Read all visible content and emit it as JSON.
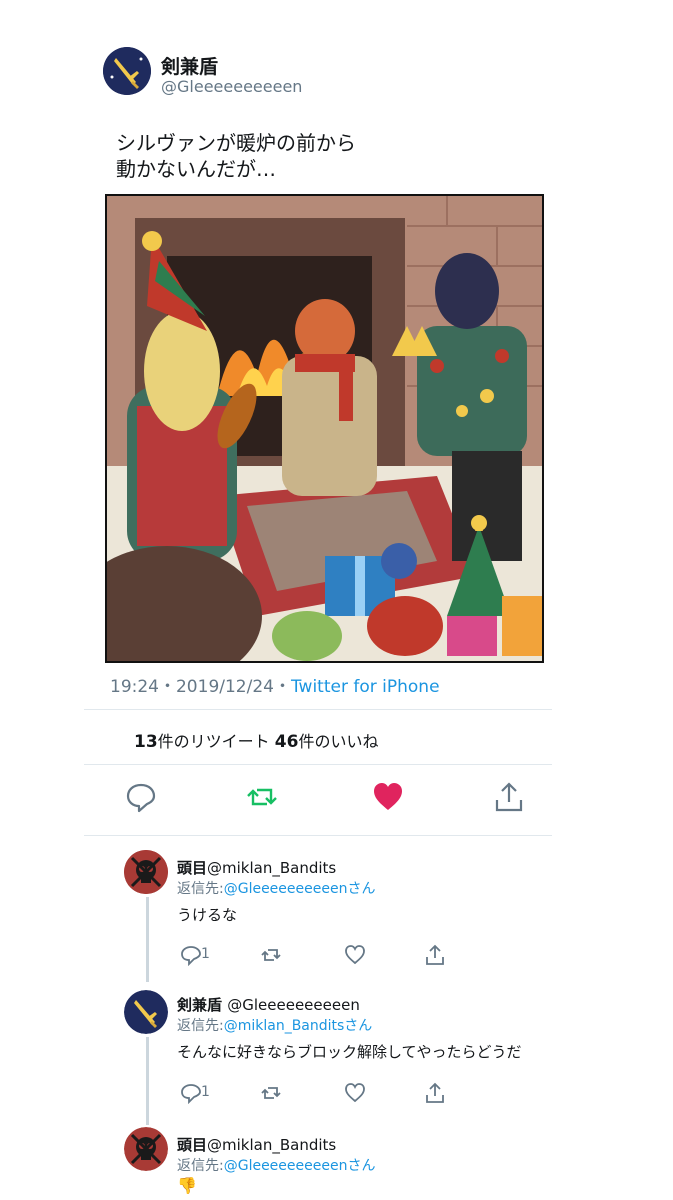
{
  "tweet": {
    "display_name": "剣兼盾",
    "handle": "@Gleeeeeeeeeen",
    "text": "シルヴァンが暖炉の前から\n動かないんだが…",
    "timestamp": "19:24・2019/12/24・",
    "source": "Twitter for iPhone",
    "retweets_count": "13",
    "retweets_label": "件のリツイート",
    "likes_count": "46",
    "likes_label": "件のいいね",
    "colors": {
      "accent": "#1b95e0",
      "retweet": "#17bf63",
      "like": "#e0245e",
      "muted": "#657786"
    }
  },
  "replies": [
    {
      "name": "頭目",
      "handle": "@miklan_Bandits",
      "reply_prefix": "返信先:",
      "reply_target": "@Gleeeeeeeeeenさん",
      "text": "うけるな",
      "reply_count": "1"
    },
    {
      "name": "剣兼盾",
      "handle": "@Gleeeeeeeeeen",
      "reply_prefix": "返信先:",
      "reply_target": "@miklan_Banditsさん",
      "text": "そんなに好きならブロック解除してやったらどうだ",
      "reply_count": "1"
    },
    {
      "name": "頭目",
      "handle": "@miklan_Bandits",
      "reply_prefix": "返信先:",
      "reply_target": "@Gleeeeeeeeeenさん",
      "text": "👎"
    }
  ],
  "icons": [
    "sword-icon",
    "skull-icon",
    "reply-icon",
    "retweet-icon",
    "like-icon",
    "share-icon"
  ]
}
